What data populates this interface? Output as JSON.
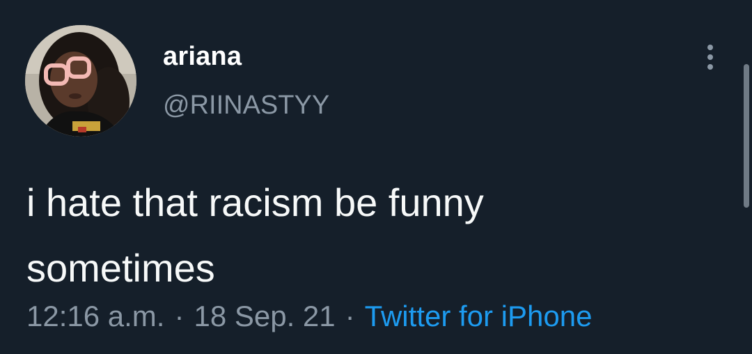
{
  "tweet": {
    "author": {
      "display_name": "ariana",
      "handle": "@RIINASTYY",
      "avatar_icon": "profile-avatar"
    },
    "more_icon": "more-vertical-icon",
    "text_line1": "i hate that racism be funny",
    "text_line2": "sometimes",
    "time": "12:16 a.m.",
    "separator": "·",
    "date": "18 Sep. 21",
    "source": "Twitter for iPhone"
  },
  "colors": {
    "background": "#151f2a",
    "primary_text": "#f7f9f9",
    "secondary_text": "#8b98a5",
    "link": "#1d9bf0"
  }
}
